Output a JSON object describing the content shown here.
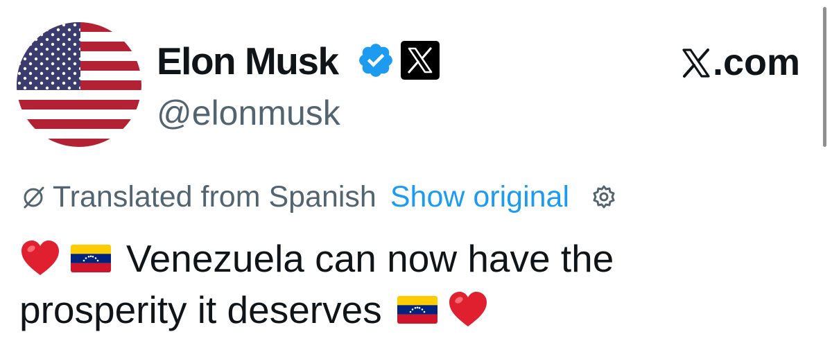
{
  "author": {
    "display_name": "Elon Musk",
    "handle": "@elonmusk",
    "avatar_icon": "us-flag-avatar",
    "verified_icon": "verified-badge-icon",
    "affiliation_icon": "x-logo-badge-icon"
  },
  "brand": {
    "logo_icon": "x-logo-icon",
    "text": ".com"
  },
  "translation": {
    "label": "Translated from Spanish",
    "show_original": "Show original",
    "icon": "translate-icon",
    "settings_icon": "gear-icon"
  },
  "tweet": {
    "line1_text": "Venezuela can now have the",
    "line2_text": "prosperity it deserves",
    "emojis": [
      "red-heart-icon",
      "venezuela-flag-icon"
    ]
  },
  "colors": {
    "text": "#0f1419",
    "secondary": "#536471",
    "link": "#1d9bf0",
    "verified": "#1d9bf0"
  }
}
